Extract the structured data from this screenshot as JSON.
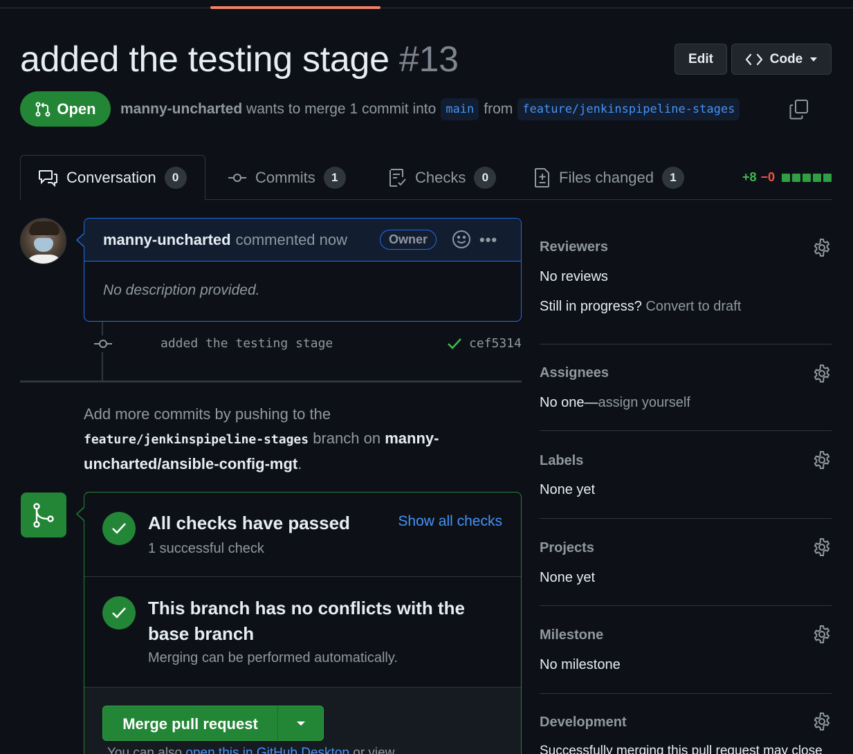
{
  "pr": {
    "title": "added the testing stage",
    "number": "#13",
    "state": "Open",
    "author": "manny-uncharted",
    "merge_text_1": "wants to merge 1 commit into",
    "base_branch": "main",
    "from_text": "from",
    "head_branch": "feature/jenkinspipeline-stages"
  },
  "header_buttons": {
    "edit": "Edit",
    "code": "Code"
  },
  "tabs": [
    {
      "label": "Conversation",
      "count": "0"
    },
    {
      "label": "Commits",
      "count": "1"
    },
    {
      "label": "Checks",
      "count": "0"
    },
    {
      "label": "Files changed",
      "count": "1"
    }
  ],
  "diffstat": {
    "additions": "+8",
    "deletions": "−0"
  },
  "comment": {
    "author": "manny-uncharted",
    "action": "commented now",
    "role": "Owner",
    "body": "No description provided."
  },
  "commit": {
    "message": "added the testing stage",
    "sha": "cef5314"
  },
  "push_hint": {
    "prefix": "Add more commits by pushing to the",
    "branch": "feature/jenkinspipeline-stages",
    "middle": "branch on",
    "repo": "manny-uncharted/ansible-config-mgt",
    "suffix": "."
  },
  "merge_box": {
    "checks_title": "All checks have passed",
    "checks_sub": "1 successful check",
    "show_checks": "Show all checks",
    "conflicts_title": "This branch has no conflicts with the base branch",
    "conflicts_sub": "Merging can be performed automatically.",
    "merge_button": "Merge pull request",
    "also_prefix": "You can also",
    "also_link": "open this in GitHub Desktop",
    "also_suffix": "or view"
  },
  "sidebar": {
    "reviewers": {
      "heading": "Reviewers",
      "value": "No reviews",
      "progress_q": "Still in progress?",
      "convert": "Convert to draft"
    },
    "assignees": {
      "heading": "Assignees",
      "value": "No one—",
      "assign": "assign yourself"
    },
    "labels": {
      "heading": "Labels",
      "value": "None yet"
    },
    "projects": {
      "heading": "Projects",
      "value": "None yet"
    },
    "milestone": {
      "heading": "Milestone",
      "value": "No milestone"
    },
    "development": {
      "heading": "Development",
      "value": "Successfully merging this pull request may close"
    }
  },
  "colors": {
    "bg": "#0d1117",
    "accent_green": "#238636",
    "link_blue": "#4493f8",
    "tab_underline": "#f78166"
  }
}
